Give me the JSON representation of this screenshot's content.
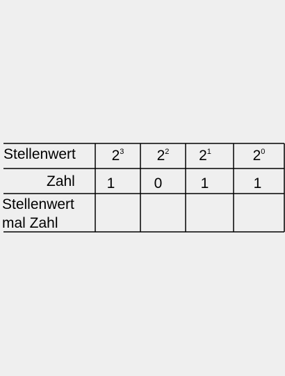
{
  "table": {
    "rows": {
      "place_value": {
        "label": "Stellenwert",
        "cells": [
          {
            "base": "2",
            "exp": "3"
          },
          {
            "base": "2",
            "exp": "2"
          },
          {
            "base": "2",
            "exp": "1"
          },
          {
            "base": "2",
            "exp": "0"
          }
        ]
      },
      "number": {
        "label": "Zahl",
        "cells": [
          "1",
          "0",
          "1",
          "1"
        ]
      },
      "product": {
        "label_line1": "Stellenwert",
        "label_line2": "mal Zahl",
        "cells": [
          "",
          "",
          "",
          ""
        ]
      }
    }
  }
}
